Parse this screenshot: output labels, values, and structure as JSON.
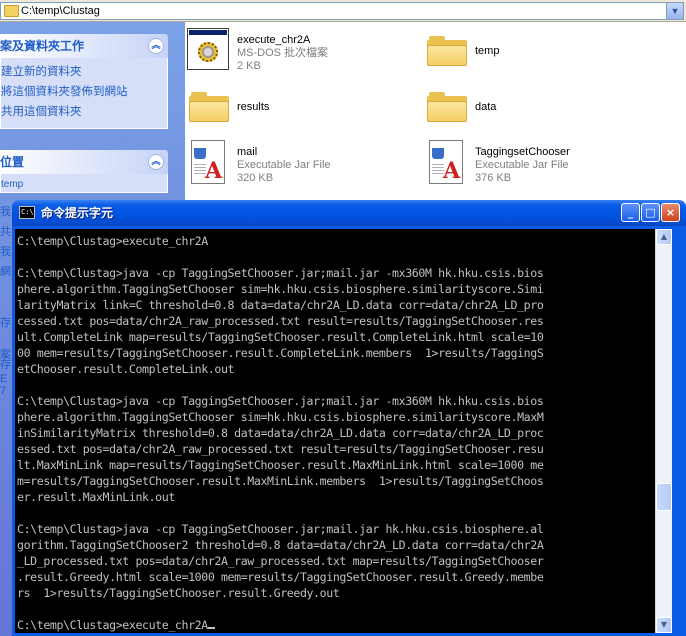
{
  "explorer": {
    "address": "C:\\temp\\Clustag",
    "taskpane": {
      "tasks_title": "案及資料夾工作",
      "tasks": [
        "建立新的資料夾",
        "將這個資料夾發佈到網站",
        "共用這個資料夾"
      ],
      "places_title": "位置",
      "places_first": "temp"
    },
    "files": [
      {
        "name": "execute_chr2A",
        "type": "MS-DOS 批次檔案",
        "size": "2 KB",
        "icon": "batch-file-icon"
      },
      {
        "name": "temp",
        "icon": "folder-icon"
      },
      {
        "name": "results",
        "icon": "folder-icon"
      },
      {
        "name": "data",
        "icon": "folder-icon"
      },
      {
        "name": "mail",
        "type": "Executable Jar File",
        "size": "320 KB",
        "icon": "jar-file-icon"
      },
      {
        "name": "TaggingsetChooser",
        "type": "Executable Jar File",
        "size": "376 KB",
        "icon": "jar-file-icon"
      }
    ],
    "side_fragments": [
      "我",
      "共",
      "我",
      "網",
      "存",
      "案",
      "存",
      "E",
      "7"
    ]
  },
  "console": {
    "title": "命令提示字元",
    "icon_label": "C:\\",
    "lines": [
      "C:\\temp\\Clustag>execute_chr2A",
      "",
      "C:\\temp\\Clustag>java -cp TaggingSetChooser.jar;mail.jar -mx360M hk.hku.csis.bios",
      "phere.algorithm.TaggingSetChooser sim=hk.hku.csis.biosphere.similarityscore.Simi",
      "larityMatrix link=C threshold=0.8 data=data/chr2A_LD.data corr=data/chr2A_LD_pro",
      "cessed.txt pos=data/chr2A_raw_processed.txt result=results/TaggingSetChooser.res",
      "ult.CompleteLink map=results/TaggingSetChooser.result.CompleteLink.html scale=10",
      "00 mem=results/TaggingSetChooser.result.CompleteLink.members  1>results/TaggingS",
      "etChooser.result.CompleteLink.out",
      "",
      "C:\\temp\\Clustag>java -cp TaggingSetChooser.jar;mail.jar -mx360M hk.hku.csis.bios",
      "phere.algorithm.TaggingSetChooser sim=hk.hku.csis.biosphere.similarityscore.MaxM",
      "inSimilarityMatrix threshold=0.8 data=data/chr2A_LD.data corr=data/chr2A_LD_proc",
      "essed.txt pos=data/chr2A_raw_processed.txt result=results/TaggingSetChooser.resu",
      "lt.MaxMinLink map=results/TaggingSetChooser.result.MaxMinLink.html scale=1000 me",
      "m=results/TaggingSetChooser.result.MaxMinLink.members  1>results/TaggingSetChoos",
      "er.result.MaxMinLink.out",
      "",
      "C:\\temp\\Clustag>java -cp TaggingSetChooser.jar;mail.jar hk.hku.csis.biosphere.al",
      "gorithm.TaggingSetChooser2 threshold=0.8 data=data/chr2A_LD.data corr=data/chr2A",
      "_LD_processed.txt pos=data/chr2A_raw_processed.txt map=results/TaggingSetChooser",
      ".result.Greedy.html scale=1000 mem=results/TaggingSetChooser.result.Greedy.membe",
      "rs  1>results/TaggingSetChooser.result.Greedy.out",
      "",
      "C:\\temp\\Clustag>execute_chr2A"
    ],
    "buttons": {
      "minimize": "_",
      "maximize": "□",
      "close": "×"
    }
  },
  "colors": {
    "console_bg": "#000000",
    "console_text": "#c0c0c0",
    "titlebar": "#0053e1",
    "taskpane": "#6375d6"
  }
}
